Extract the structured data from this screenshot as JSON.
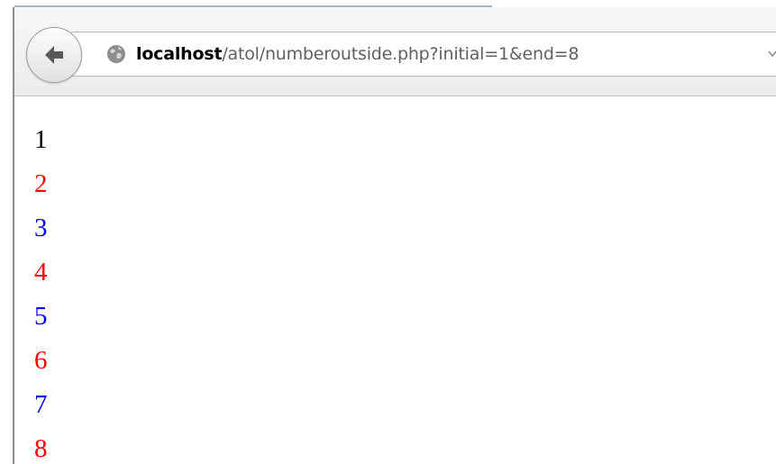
{
  "browser": {
    "url_host": "localhost",
    "url_path": "/atol/numberoutside.php?initial=1&end=8",
    "back_icon": "arrow-left-icon",
    "site_icon": "globe-icon",
    "dropdown_icon": "chevron-down-icon"
  },
  "page": {
    "numbers": [
      {
        "text": "1",
        "color": "#000000"
      },
      {
        "text": "2",
        "color": "#ff0000"
      },
      {
        "text": "3",
        "color": "#0000ff"
      },
      {
        "text": "4",
        "color": "#ff0000"
      },
      {
        "text": "5",
        "color": "#0000ff"
      },
      {
        "text": "6",
        "color": "#ff0000"
      },
      {
        "text": "7",
        "color": "#0000ff"
      },
      {
        "text": "8",
        "color": "#ff0000"
      }
    ]
  }
}
